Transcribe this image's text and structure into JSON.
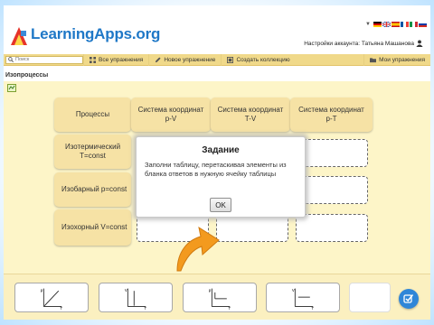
{
  "header": {
    "logo_text": "LearningApps.org",
    "account_label": "Настройки аккаунта: Татьяна Машанова",
    "languages": [
      "de",
      "gb",
      "es",
      "fr",
      "it",
      "ru"
    ]
  },
  "nav": {
    "search_placeholder": "Поиск",
    "items": [
      {
        "label": "Все упражнения",
        "icon": "grid-icon"
      },
      {
        "label": "Новое упражнение",
        "icon": "pencil-icon"
      },
      {
        "label": "Создать коллекцию",
        "icon": "collection-icon"
      },
      {
        "label": "Мои упражнения",
        "icon": "folder-icon"
      }
    ]
  },
  "page_title": "Изопроцессы",
  "table": {
    "header_row": {
      "first": "Процессы",
      "columns": [
        {
          "line1": "Система координат",
          "line2": "p-V"
        },
        {
          "line1": "Система координат",
          "line2": "T-V"
        },
        {
          "line1": "Система координат",
          "line2": "p-T"
        }
      ]
    },
    "rows": [
      {
        "line1": "Изотермический",
        "line2": "T=const"
      },
      {
        "line1": "Изобарный p=const",
        "line2": ""
      },
      {
        "line1": "Изохорный V=const",
        "line2": ""
      }
    ]
  },
  "dialog": {
    "title": "Задание",
    "text": "Заполни таблицу, перетаскивая элементы из бланка ответов в нужную ячейку таблицы",
    "ok_label": "OK"
  },
  "answer_cards": [
    {
      "name": "graph-card-1",
      "x_label": "T",
      "y_label": "p"
    },
    {
      "name": "graph-card-2",
      "x_label": "T",
      "y_label": "V"
    },
    {
      "name": "graph-card-3",
      "x_label": "T",
      "y_label": "p"
    },
    {
      "name": "graph-card-4",
      "x_label": "T",
      "y_label": "V"
    },
    {
      "name": "graph-card-5",
      "x_label": "",
      "y_label": ""
    }
  ],
  "colors": {
    "accent": "#1f78c7",
    "nav_bg": "#f0d98a",
    "app_bg": "#fdf5c8",
    "tile": "#f6e2a5",
    "arrow": "#f39a1e",
    "check": "#2f86d8"
  }
}
